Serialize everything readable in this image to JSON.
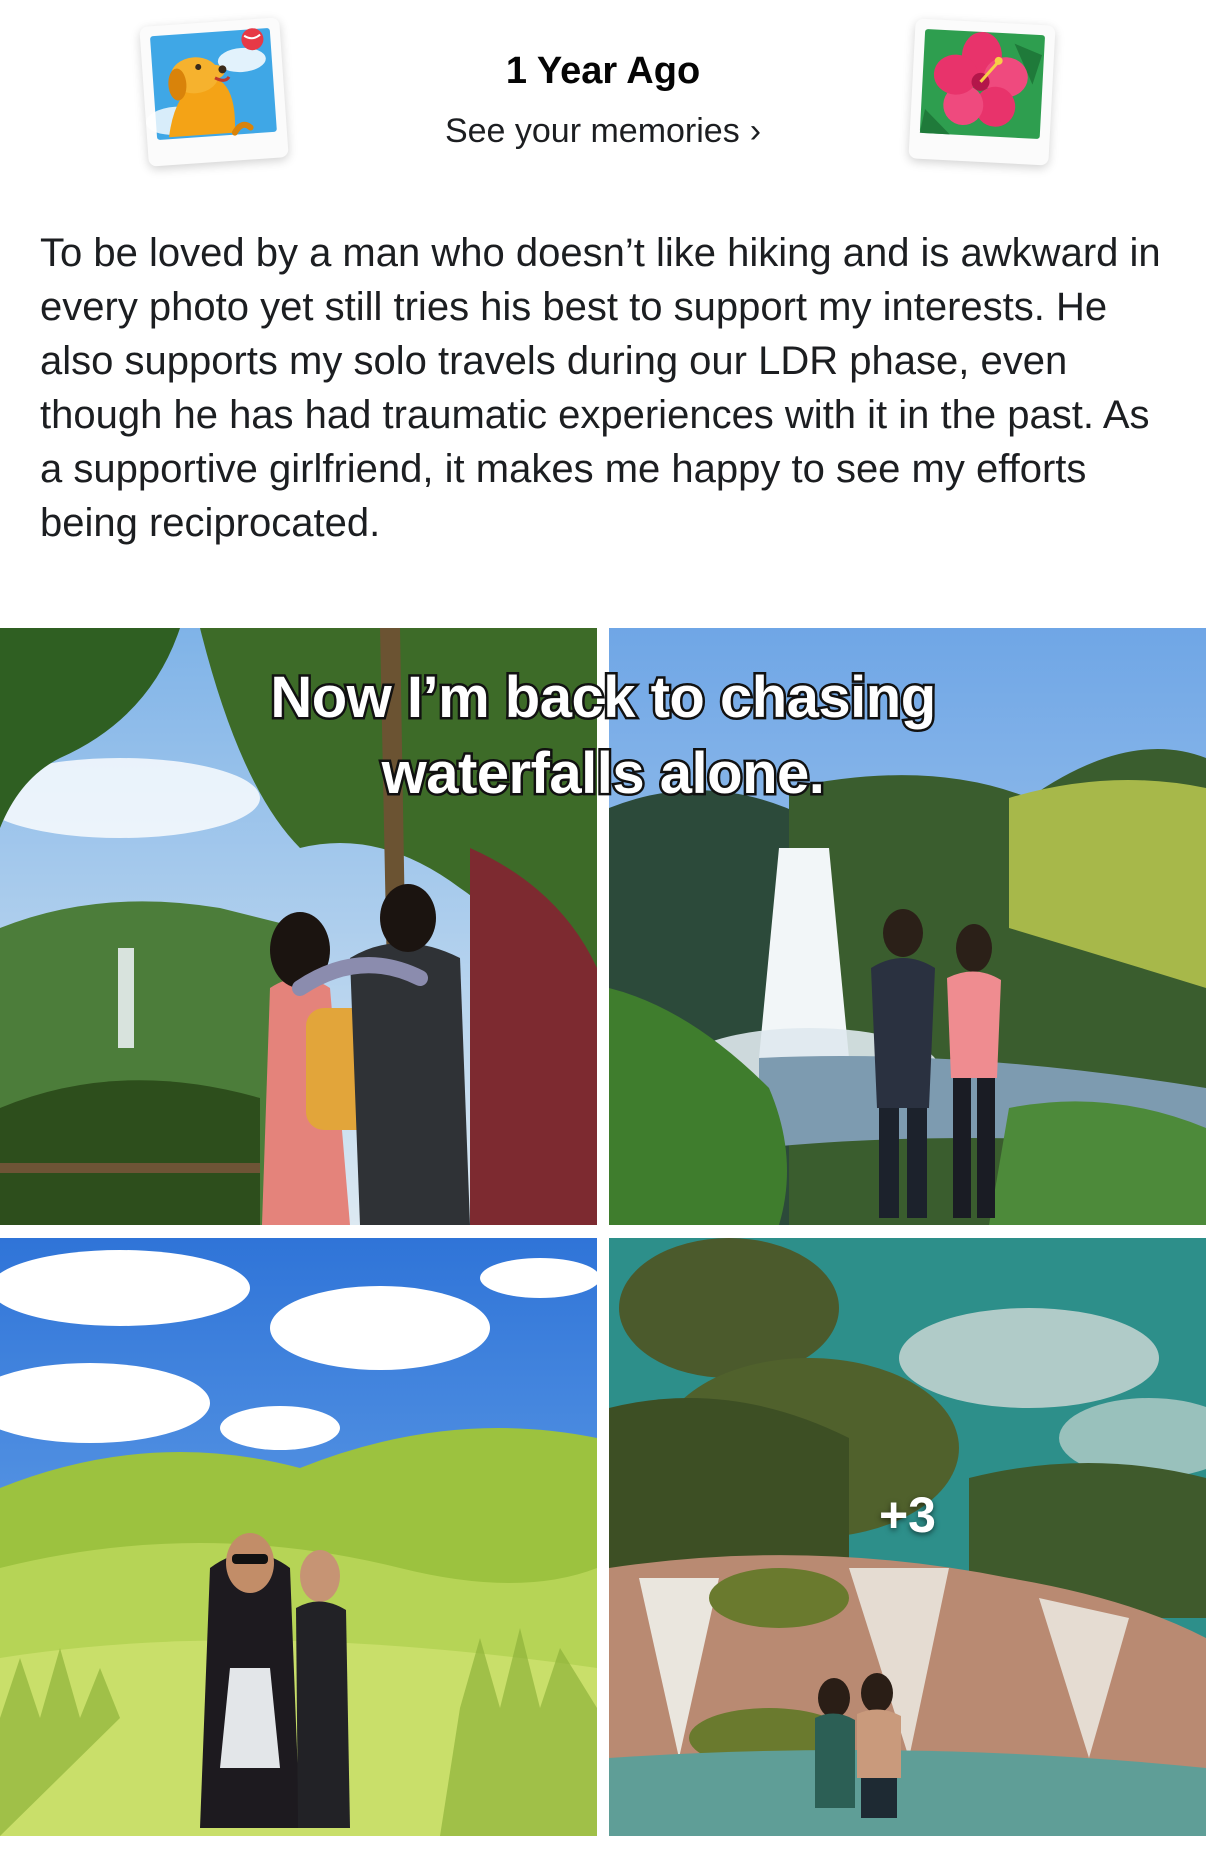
{
  "memories": {
    "title": "1 Year Ago",
    "link_label": "See your memories",
    "link_chevron": "›",
    "left_sticker_icon": "dog-with-ball-photo-icon",
    "right_sticker_icon": "hibiscus-photo-icon"
  },
  "post": {
    "text": "To be loved by a man who doesn’t like hiking and is awkward in every photo yet still tries his best to support my interests. He also supports my solo travels during our LDR phase, even though he has had traumatic experiences with it in the past. As a supportive girlfriend, it makes me happy to see my efforts being reciprocated."
  },
  "caption_overlay": {
    "line1": "Now I’m back to chasing",
    "line2": "waterfalls alone."
  },
  "photos": {
    "more_count": "+3"
  }
}
